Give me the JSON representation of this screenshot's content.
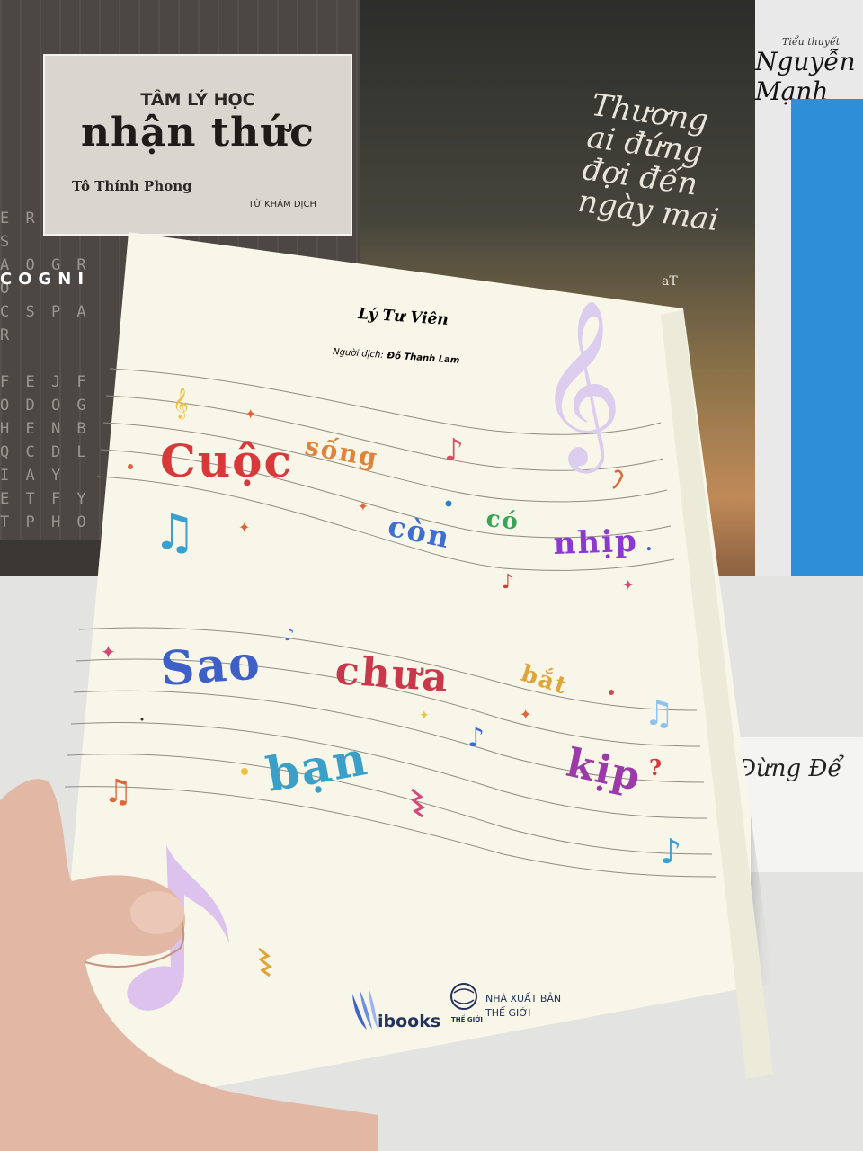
{
  "background": {
    "left_book": {
      "subtitle": "TÂM LÝ HỌC",
      "title": "nhận thức",
      "author": "Tô Thính Phong",
      "translator": "TỪ KHÁM DỊCH",
      "spine_word": "COGNI"
    },
    "middle_book": {
      "title": "Thương ai đứng đợi đến ngày mai",
      "author_mark": "aT"
    },
    "right_book": {
      "subtitle": "Tiểu thuyết",
      "author": "Nguyễn Mạnh"
    },
    "lower_right_book": {
      "title": "Đừng Để"
    }
  },
  "cover": {
    "author": "Lý Tư Viên",
    "translator_label": "Người dịch:",
    "translator_name": "Đỗ Thanh Lam",
    "title_words": [
      {
        "text": "Cuộc",
        "color": "#d9383a"
      },
      {
        "text": "sống",
        "color": "#e0833a"
      },
      {
        "text": "có",
        "color": "#3aa35a"
      },
      {
        "text": "còn",
        "color": "#3e6fd0"
      },
      {
        "text": "nhịp",
        "color": "#8a3ad0"
      },
      {
        "text": "Sao",
        "color": "#3e5fc8"
      },
      {
        "text": "chưa",
        "color": "#c8384a"
      },
      {
        "text": "bắt",
        "color": "#e0a53a"
      },
      {
        "text": "bạn",
        "color": "#3aa0c8"
      },
      {
        "text": "kịp",
        "color": "#9b3aa8"
      }
    ],
    "title_punct_1": ".",
    "title_punct_2": "?",
    "publisher_brand": "ibooks",
    "publisher_mark": "THẾ GIỚI",
    "publisher_name_line1": "NHÀ XUẤT BẢN",
    "publisher_name_line2": "THẾ GIỚI",
    "colors": {
      "cover_bg": "#f8f6e8",
      "staff_lines": "#8f8c84",
      "clef": "#d9c8ec",
      "brand_blue": "#3f63c8"
    }
  }
}
